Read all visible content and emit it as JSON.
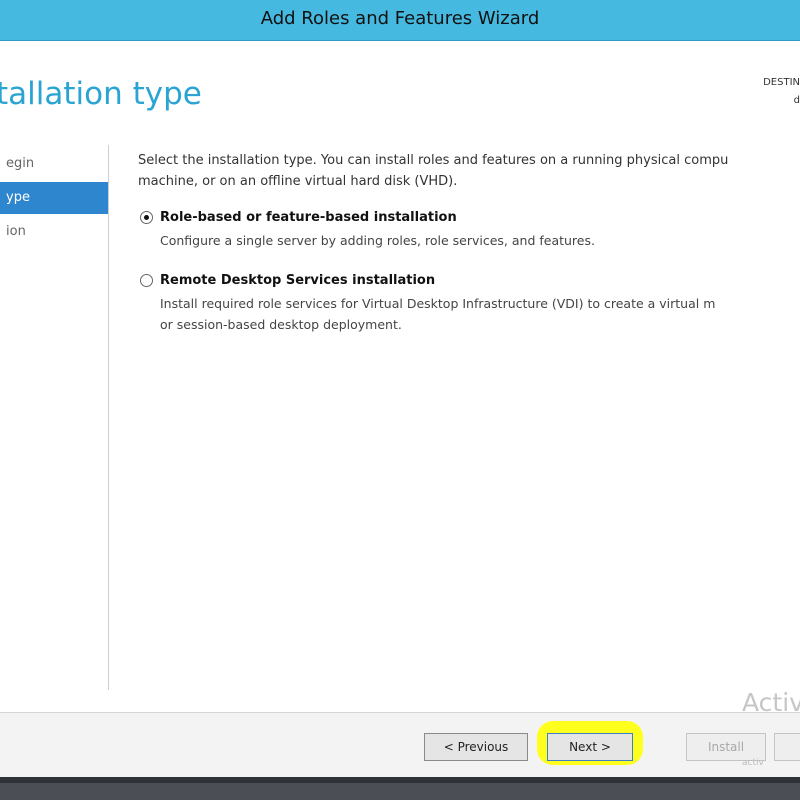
{
  "window": {
    "title": "Add Roles and Features Wizard"
  },
  "header": {
    "page_title": "tallation type",
    "destination_line1": "DESTIN",
    "destination_line2": "d"
  },
  "nav": {
    "items": [
      {
        "label": "egin",
        "selected": false
      },
      {
        "label": "ype",
        "selected": true
      },
      {
        "label": "ion",
        "selected": false
      }
    ]
  },
  "main": {
    "intro_line1": "Select the installation type. You can install roles and features on a running physical compu",
    "intro_line2": "machine, or on an offline virtual hard disk (VHD).",
    "options": [
      {
        "label": "Role-based or feature-based installation",
        "description_line1": "Configure a single server by adding roles, role services, and features.",
        "description_line2": "",
        "checked": true
      },
      {
        "label": "Remote Desktop Services installation",
        "description_line1": "Install required role services for Virtual Desktop Infrastructure (VDI) to create a virtual m",
        "description_line2": "or session-based desktop deployment.",
        "checked": false
      }
    ]
  },
  "footer": {
    "previous_label": "< Previous",
    "next_label": "Next >",
    "install_label": "Install",
    "highlight_color": "#ffff1e"
  },
  "watermark": {
    "text": "Activ",
    "subtext": "activ"
  },
  "colors": {
    "titlebar": "#46b9e0",
    "accent": "#2aa4d2",
    "nav_selected": "#2e86cf"
  }
}
